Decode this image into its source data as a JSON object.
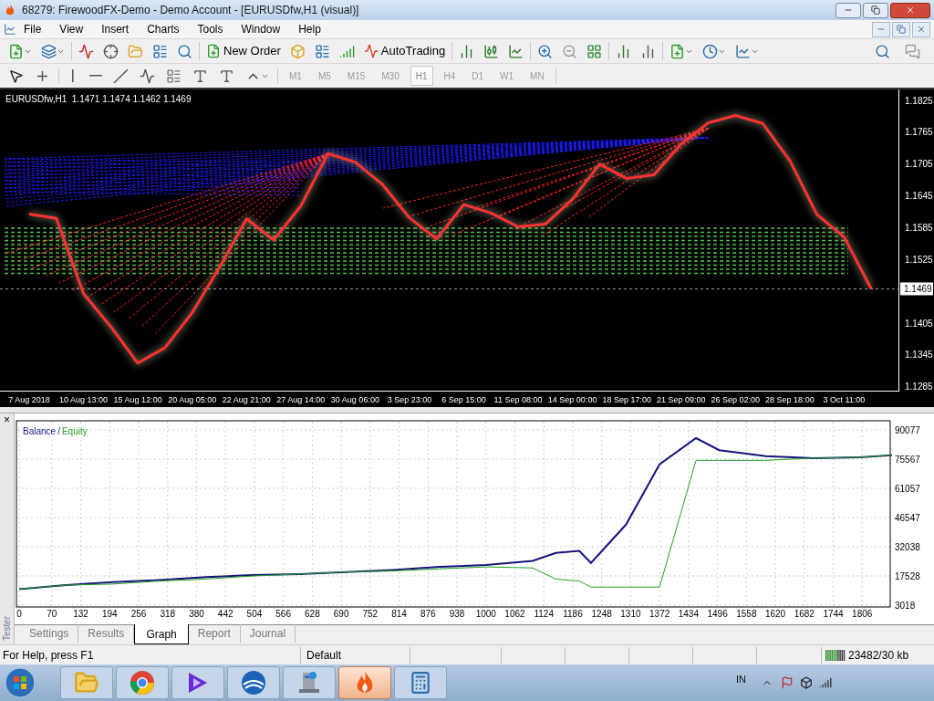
{
  "window": {
    "title": "68279: FirewoodFX-Demo - Demo Account - [EURUSDfw,H1 (visual)]"
  },
  "menu": [
    "File",
    "View",
    "Insert",
    "Charts",
    "Tools",
    "Window",
    "Help"
  ],
  "toolbar": {
    "new_order": "New Order",
    "auto_trading": "AutoTrading"
  },
  "timeframes": [
    {
      "label": "M1",
      "selected": false
    },
    {
      "label": "M5",
      "selected": false
    },
    {
      "label": "M15",
      "selected": false
    },
    {
      "label": "M30",
      "selected": false
    },
    {
      "label": "H1",
      "selected": true
    },
    {
      "label": "H4",
      "selected": false
    },
    {
      "label": "D1",
      "selected": false
    },
    {
      "label": "W1",
      "selected": false
    },
    {
      "label": "MN",
      "selected": false
    }
  ],
  "chart": {
    "header": "EURUSDfw,H1  1.1471 1.1474 1.1462 1.1469",
    "current_price": "1.1469",
    "chart_data": {
      "type": "line",
      "categories": [
        "7 Aug 2018",
        null,
        "10 Aug 13:00",
        null,
        "15 Aug 12:00",
        null,
        "20 Aug 05:00",
        null,
        "22 Aug 21:00",
        null,
        "27 Aug 14:00",
        null,
        "30 Aug 06:00",
        null,
        "3 Sep 23:00",
        null,
        "6 Sep 15:00",
        null,
        "11 Sep 08:00",
        null,
        "14 Sep 00:00",
        null,
        "18 Sep 17:00",
        null,
        "21 Sep 09:00",
        null,
        "26 Sep 02:00",
        null,
        "28 Sep 18:00",
        null,
        "3 Oct 11:00",
        null
      ],
      "series": [
        {
          "color": "#ff3030",
          "values": [
            1.161,
            1.1602,
            1.146,
            1.1398,
            1.1329,
            1.1358,
            1.1424,
            1.1509,
            1.1601,
            1.1561,
            1.1625,
            1.1724,
            1.1708,
            1.1666,
            1.1603,
            1.1563,
            1.1628,
            1.1612,
            1.1586,
            1.1591,
            1.1638,
            1.1704,
            1.1677,
            1.1684,
            1.1742,
            1.1782,
            1.1796,
            1.1781,
            1.1711,
            1.1609,
            1.1567,
            1.1469
          ]
        }
      ],
      "ylim": [
        1.1277,
        1.1845
      ],
      "yticks": [
        {
          "value": 1.1825,
          "label": "1.1825"
        },
        {
          "value": 1.1765,
          "label": "1.1765"
        },
        {
          "value": 1.1705,
          "label": "1.1705"
        },
        {
          "value": 1.1645,
          "label": "1.1645"
        },
        {
          "value": 1.1585,
          "label": "1.1585"
        },
        {
          "value": 1.1525,
          "label": "1.1525"
        },
        {
          "value": 1.1405,
          "label": "1.1405"
        },
        {
          "value": 1.1345,
          "label": "1.1345"
        },
        {
          "value": 1.1285,
          "label": "1.1285"
        }
      ]
    }
  },
  "tester": {
    "side_label": "Tester",
    "close": "×",
    "legend_separator": "/",
    "chart_data": {
      "type": "line",
      "grid": true,
      "x": [
        0,
        100,
        200,
        300,
        400,
        500,
        600,
        700,
        800,
        900,
        1000,
        1100,
        1150,
        1200,
        1225,
        1300,
        1372,
        1450,
        1500,
        1600,
        1700,
        1800,
        1870
      ],
      "series": [
        {
          "name": "Balance",
          "color": "#14147a",
          "values": [
            11000,
            13000,
            14500,
            15500,
            17000,
            18000,
            18500,
            19500,
            20500,
            22000,
            23000,
            25000,
            29000,
            30000,
            24000,
            43000,
            73000,
            86000,
            80000,
            77000,
            76000,
            76500,
            77500
          ]
        },
        {
          "name": "Equity",
          "color": "#22a022",
          "values": [
            11000,
            13000,
            13500,
            15000,
            16000,
            17500,
            18500,
            19500,
            20000,
            21000,
            22000,
            21500,
            16000,
            15000,
            12000,
            12000,
            12000,
            75000,
            75000,
            75000,
            76000,
            76500,
            77500
          ]
        }
      ],
      "xlim": [
        0,
        1870
      ],
      "ylim": [
        3018,
        90077
      ],
      "xticks": [
        0,
        70,
        132,
        194,
        256,
        318,
        380,
        442,
        504,
        566,
        628,
        690,
        752,
        814,
        876,
        938,
        1000,
        1062,
        1124,
        1186,
        1248,
        1310,
        1372,
        1434,
        1496,
        1558,
        1620,
        1682,
        1744,
        1806
      ],
      "yticks": [
        3018,
        17528,
        32038,
        46547,
        61057,
        75567,
        90077
      ]
    },
    "tabs": [
      {
        "label": "Settings",
        "selected": false
      },
      {
        "label": "Results",
        "selected": false
      },
      {
        "label": "Graph",
        "selected": true
      },
      {
        "label": "Report",
        "selected": false
      },
      {
        "label": "Journal",
        "selected": false
      }
    ]
  },
  "status_bar": {
    "help": "For Help, press F1",
    "profile": "Default",
    "traffic": "23482/30 kb"
  },
  "taskbar": {
    "apps": [
      {
        "kind": "folder",
        "selected": false
      },
      {
        "kind": "browser",
        "selected": false
      },
      {
        "kind": "triangle",
        "selected": false
      },
      {
        "kind": "globe",
        "selected": false
      },
      {
        "kind": "computer",
        "selected": false
      },
      {
        "kind": "flame",
        "selected": true
      },
      {
        "kind": "calculator",
        "selected": false
      }
    ],
    "language": "IN"
  }
}
